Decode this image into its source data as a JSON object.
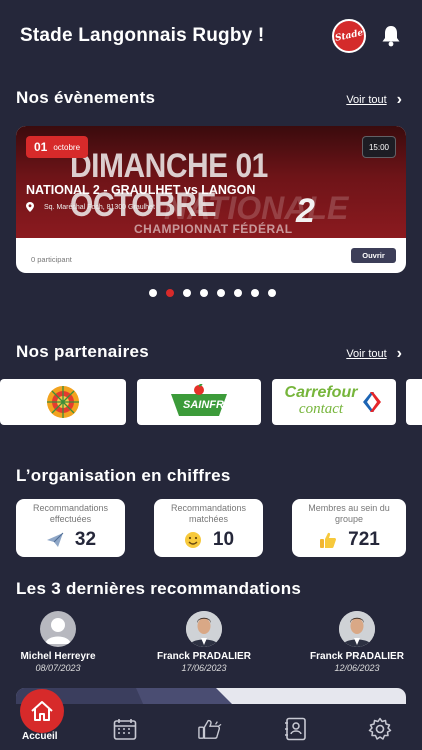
{
  "header": {
    "title": "Stade Langonnais Rugby !",
    "logo_text": "Stade"
  },
  "events": {
    "title": "Nos évènements",
    "see_all": "Voir tout",
    "card": {
      "banner_headline": "DIMANCHE 01 OCTOBRE",
      "banner_line2": "NATIONALE",
      "banner_number": "2",
      "banner_line3": "CHAMPIONNAT FÉDÉRAL",
      "day": "01",
      "month": "octobre",
      "time": "15:00",
      "match": "NATIONAL 2 - GRAULHET vs LANGON",
      "address": "Sq. Maréchal Foch, 81300 Graulhet",
      "participants": "0 participant",
      "open_label": "Ouvrir"
    },
    "pager": {
      "count": 8,
      "active_index": 1
    }
  },
  "partners": {
    "title": "Nos partenaires",
    "see_all": "Voir tout",
    "items": [
      {
        "name": "Casino Langonnais",
        "label": ""
      },
      {
        "name": "Sainfruit",
        "label": "SAINFRUIT"
      },
      {
        "name": "Carrefour contact",
        "label": "Carrefour",
        "sub": "contact"
      }
    ]
  },
  "stats": {
    "title": "L’organisation en chiffres",
    "items": [
      {
        "label": "Recommandations effectuées",
        "value": "32",
        "icon": "paper-plane-icon"
      },
      {
        "label": "Recommandations matchées",
        "value": "10",
        "icon": "smile-icon"
      },
      {
        "label": "Membres au sein du groupe",
        "value": "721",
        "icon": "thumbs-up-icon"
      }
    ]
  },
  "recommendations": {
    "title": "Les 3 dernières recommandations",
    "items": [
      {
        "name": "Michel Herreyre",
        "date": "08/07/2023"
      },
      {
        "name": "Franck PRADALIER",
        "date": "17/06/2023"
      },
      {
        "name": "Franck PRADALIER",
        "date": "12/06/2023"
      }
    ]
  },
  "tabbar": {
    "home_label": "Accueil",
    "tabs": [
      "calendar-icon",
      "thumbs-up-icon",
      "contacts-icon",
      "settings-icon"
    ]
  },
  "colors": {
    "background": "#25273a",
    "accent": "#d72a2a",
    "card": "#ffffff"
  }
}
